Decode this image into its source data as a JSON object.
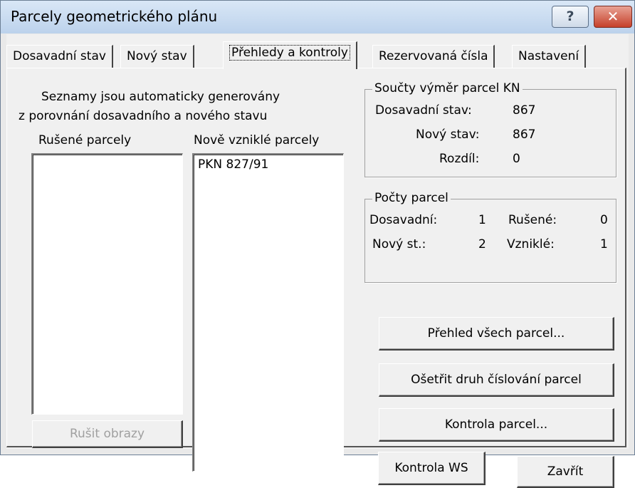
{
  "window": {
    "title": "Parcely geometrického plánu",
    "help_label": "?",
    "close_label": "✕"
  },
  "tabs": [
    {
      "label": "Dosavadní stav"
    },
    {
      "label": "Nový stav"
    },
    {
      "label": "Přehledy a kontroly"
    },
    {
      "label": "Rezervovaná čísla"
    },
    {
      "label": "Nastavení"
    }
  ],
  "active_tab": "Přehledy a kontroly",
  "lists": {
    "info_line1": "Seznamy jsou automaticky generovány",
    "info_line2": "z porovnání dosavadního a nového stavu",
    "cancelled_header": "Rušené parcely",
    "cancelled_items": [],
    "new_header": "Nově vzniklé parcely",
    "new_items": [
      "PKN 827/91"
    ],
    "cancel_images_button": "Rušit obrazy"
  },
  "areas": {
    "legend": "Součty výměr parcel KN",
    "previous_label": "Dosavadní stav:",
    "previous_value": "867",
    "new_label": "Nový stav:",
    "new_value": "867",
    "difference_label": "Rozdíl:",
    "difference_value": "0"
  },
  "counts": {
    "legend": "Počty parcel",
    "previous_label": "Dosavadní:",
    "previous_value": "1",
    "cancelled_label": "Rušené:",
    "cancelled_value": "0",
    "new_label": "Nový st.:",
    "new_value": "2",
    "created_label": "Vzniklé:",
    "created_value": "1"
  },
  "buttons": {
    "overview": "Přehled všech parcel...",
    "numbering": "Ošetřit druh číslování parcel",
    "check": "Kontrola parcel...",
    "check_ws": "Kontrola WS",
    "close": "Zavřít"
  }
}
